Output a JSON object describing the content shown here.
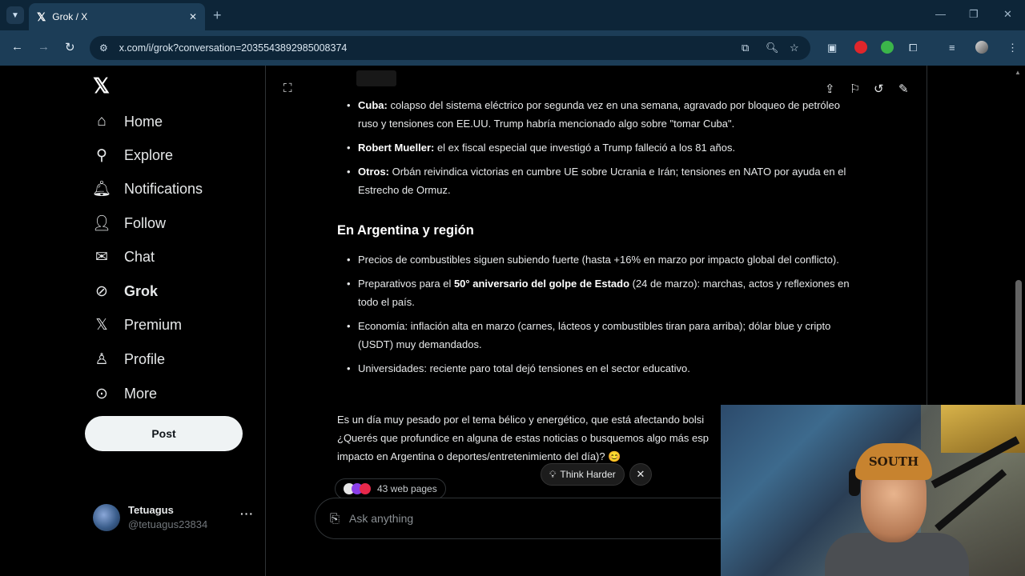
{
  "browser": {
    "tab_title": "Grok / X",
    "url": "x.com/i/grok?conversation=2035543892985008374"
  },
  "sidebar": {
    "items": [
      {
        "label": "Home",
        "icon": "home-icon"
      },
      {
        "label": "Explore",
        "icon": "search-icon"
      },
      {
        "label": "Notifications",
        "icon": "bell-icon"
      },
      {
        "label": "Follow",
        "icon": "add-person-icon"
      },
      {
        "label": "Chat",
        "icon": "mail-icon"
      },
      {
        "label": "Grok",
        "icon": "grok-icon"
      },
      {
        "label": "Premium",
        "icon": "x-logo-icon"
      },
      {
        "label": "Profile",
        "icon": "person-icon"
      },
      {
        "label": "More",
        "icon": "more-circle-icon"
      }
    ],
    "post_label": "Post",
    "account": {
      "name": "Tetuagus",
      "handle": "@tetuagus23834"
    }
  },
  "content": {
    "world_items": [
      {
        "bold": "Cuba:",
        "text": " colapso del sistema eléctrico por segunda vez en una semana, agravado por bloqueo de petróleo ruso y tensiones con EE.UU. Trump habría mencionado algo sobre \"tomar Cuba\"."
      },
      {
        "bold": "Robert Mueller:",
        "text": " el ex fiscal especial que investigó a Trump falleció a los 81 años."
      },
      {
        "bold": "Otros:",
        "text": " Orbán reivindica victorias en cumbre UE sobre Ucrania e Irán; tensiones en NATO por ayuda en el Estrecho de Ormuz."
      }
    ],
    "heading": "En Argentina y región",
    "arg_items": [
      {
        "pre": "Precios de combustibles siguen subiendo fuerte (hasta +16% en marzo por impacto global del conflicto).",
        "bold": "",
        "post": ""
      },
      {
        "pre": "Preparativos para el ",
        "bold": "50° aniversario del golpe de Estado",
        "post": " (24 de marzo): marchas, actos y reflexiones en todo el país."
      },
      {
        "pre": "Economía: inflación alta en marzo (carnes, lácteos y combustibles tiran para arriba); dólar blue y cripto (USDT) muy demandados.",
        "bold": "",
        "post": ""
      },
      {
        "pre": "Universidades: reciente paro total dejó tensiones en el sector educativo.",
        "bold": "",
        "post": ""
      }
    ],
    "closing_line1": "Es un día muy pesado por el tema bélico y energético, que está afectando bolsi",
    "closing_line2": "¿Querés que profundice en alguna de estas noticias o busquemos algo más esp",
    "closing_line3": "impacto en Argentina o deportes/entretenimiento del día)? 😊",
    "sources_label": "43 web pages",
    "think_harder": "Think Harder",
    "ask_placeholder": "Ask anything"
  },
  "colors": {
    "chrome_dark": "#0d2538",
    "chrome": "#1c3d57",
    "background": "#000000",
    "text": "#e7e9ea",
    "muted": "#71767b"
  }
}
